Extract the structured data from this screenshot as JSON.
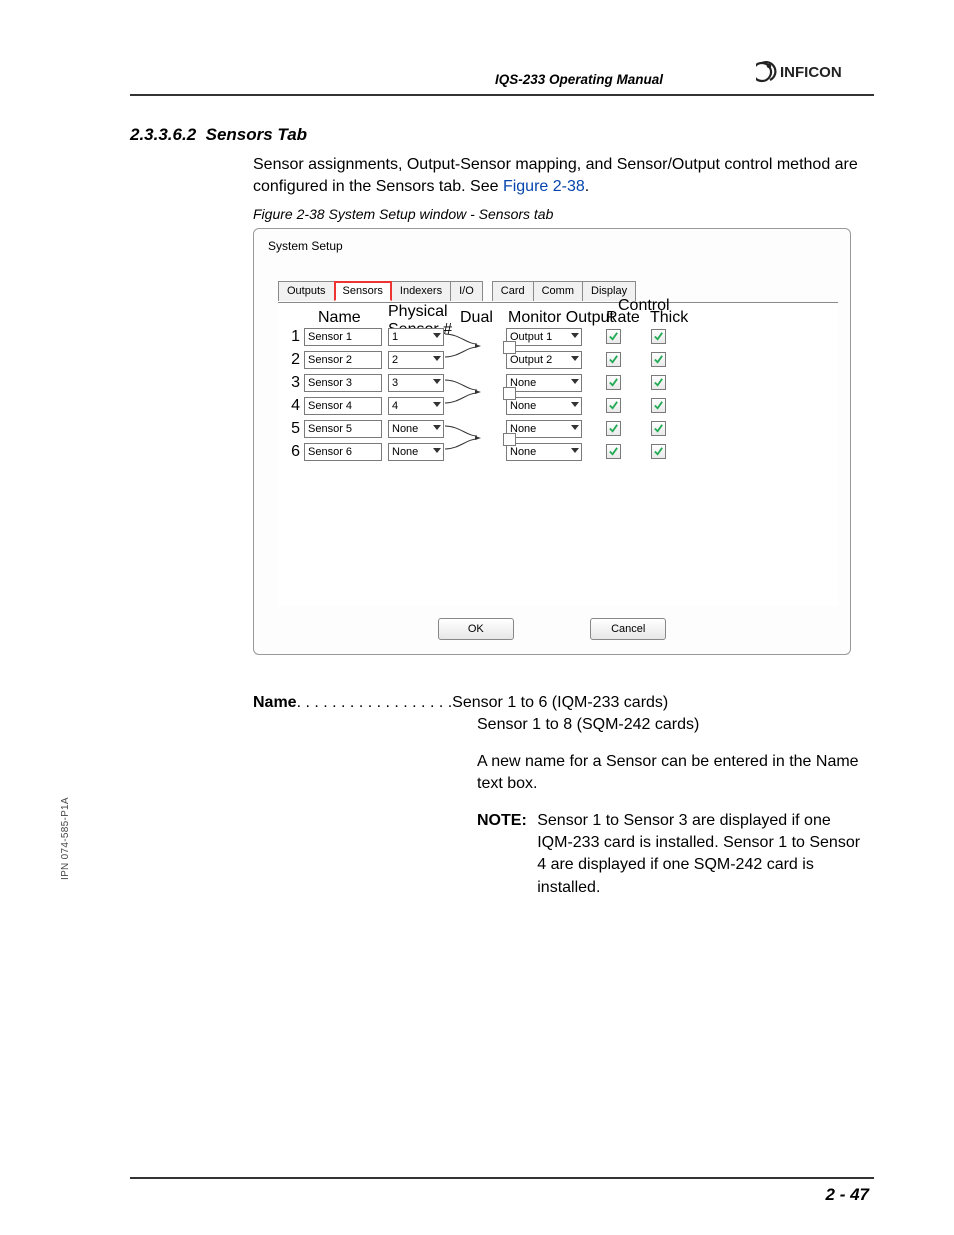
{
  "header": {
    "manual_title": "IQS-233 Operating Manual",
    "logo_text": "INFICON"
  },
  "section": {
    "number": "2.3.3.6.2",
    "title": "Sensors Tab",
    "body_text_a": "Sensor assignments, Output-Sensor mapping, and Sensor/Output control method are configured in the Sensors tab. See ",
    "body_link": "Figure 2-38",
    "body_text_b": "."
  },
  "figure": {
    "caption": "Figure 2-38  System Setup window - Sensors tab"
  },
  "dialog": {
    "title": "System Setup",
    "tabs": [
      "Outputs",
      "Sensors",
      "Indexers",
      "I/O",
      "Card",
      "Comm",
      "Display"
    ],
    "active_tab_index": 1,
    "columns": {
      "name": "Name",
      "phys": "Physical\nSensor #",
      "dual": "Dual",
      "monitor": "Monitor Output",
      "control": "Control",
      "rate": "Rate",
      "thick": "Thick"
    },
    "rows": [
      {
        "n": "1",
        "name": "Sensor 1",
        "phys": "1",
        "monitor": "Output 1",
        "rate": true,
        "thick": true,
        "dual_box": false
      },
      {
        "n": "2",
        "name": "Sensor 2",
        "phys": "2",
        "monitor": "Output 2",
        "rate": true,
        "thick": true,
        "dual_box": false
      },
      {
        "n": "3",
        "name": "Sensor 3",
        "phys": "3",
        "monitor": "None",
        "rate": true,
        "thick": true,
        "dual_box": false
      },
      {
        "n": "4",
        "name": "Sensor 4",
        "phys": "4",
        "monitor": "None",
        "rate": true,
        "thick": true,
        "dual_box": false
      },
      {
        "n": "5",
        "name": "Sensor 5",
        "phys": "None",
        "monitor": "None",
        "rate": true,
        "thick": true,
        "dual_box": false
      },
      {
        "n": "6",
        "name": "Sensor 6",
        "phys": "None",
        "monitor": "None",
        "rate": true,
        "thick": true,
        "dual_box": false
      }
    ],
    "dual_boxes": [
      false,
      false,
      false
    ],
    "buttons": {
      "ok": "OK",
      "cancel": "Cancel"
    }
  },
  "description": {
    "term": "Name",
    "dots": " . . . . . . . . . . . . . . . . . . ",
    "def1a": "Sensor 1 to 6 (IQM-233 cards)",
    "def1b": "Sensor 1 to 8 (SQM-242 cards)",
    "def2": "A new name for a Sensor can be entered in the Name text box.",
    "note_label": "NOTE:",
    "note_body": "Sensor 1 to Sensor 3 are displayed if one IQM-233 card is installed. Sensor 1 to Sensor 4 are displayed if one SQM-242 card is installed."
  },
  "footer": {
    "ipn": "IPN 074-585-P1A",
    "page": "2 - 47"
  }
}
